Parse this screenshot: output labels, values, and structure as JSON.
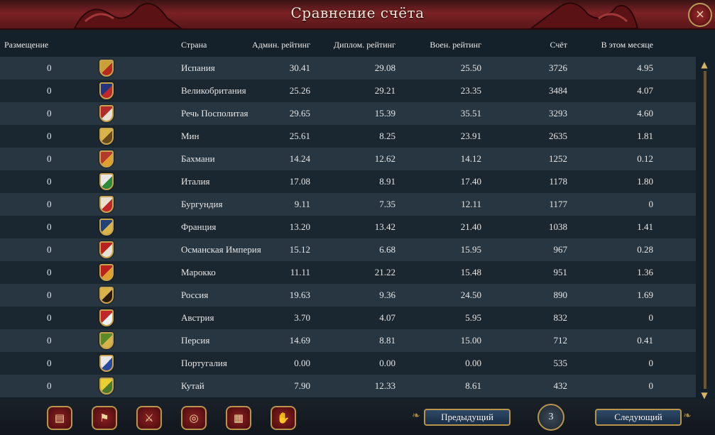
{
  "window": {
    "title": "Сравнение счёта",
    "close_icon": "×"
  },
  "headers": {
    "placement": "Размещение",
    "country": "Страна",
    "admin": "Админ. рейтинг",
    "diplo": "Диплом. рейтинг",
    "military": "Воен. рейтинг",
    "score": "Счёт",
    "this_month": "В этом месяце"
  },
  "rows": [
    {
      "place": "0",
      "country": "Испания",
      "admin": "30.41",
      "diplo": "29.08",
      "military": "25.50",
      "score": "3726",
      "month": "4.95",
      "flag_color": "#c9a13a",
      "flag_accent": "#b52a1f"
    },
    {
      "place": "0",
      "country": "Великобритания",
      "admin": "25.26",
      "diplo": "29.21",
      "military": "23.35",
      "score": "3484",
      "month": "4.07",
      "flag_color": "#22357a",
      "flag_accent": "#c0262a"
    },
    {
      "place": "0",
      "country": "Речь Посполитая",
      "admin": "29.65",
      "diplo": "15.39",
      "military": "35.51",
      "score": "3293",
      "month": "4.60",
      "flag_color": "#b22a2a",
      "flag_accent": "#e8e0d0"
    },
    {
      "place": "0",
      "country": "Мин",
      "admin": "25.61",
      "diplo": "8.25",
      "military": "23.91",
      "score": "2635",
      "month": "1.81",
      "flag_color": "#d9b44a",
      "flag_accent": "#6a4a1a"
    },
    {
      "place": "0",
      "country": "Бахмани",
      "admin": "14.24",
      "diplo": "12.62",
      "military": "14.12",
      "score": "1252",
      "month": "0.12",
      "flag_color": "#b23a2a",
      "flag_accent": "#e0a030"
    },
    {
      "place": "0",
      "country": "Италия",
      "admin": "17.08",
      "diplo": "8.91",
      "military": "17.40",
      "score": "1178",
      "month": "1.80",
      "flag_color": "#e6e6e6",
      "flag_accent": "#2a8a3a"
    },
    {
      "place": "0",
      "country": "Бургундия",
      "admin": "9.11",
      "diplo": "7.35",
      "military": "12.11",
      "score": "1177",
      "month": "0",
      "flag_color": "#e8e0d0",
      "flag_accent": "#c0262a"
    },
    {
      "place": "0",
      "country": "Франция",
      "admin": "13.20",
      "diplo": "13.42",
      "military": "21.40",
      "score": "1038",
      "month": "1.41",
      "flag_color": "#24427a",
      "flag_accent": "#d9b44a"
    },
    {
      "place": "0",
      "country": "Османская Империя",
      "admin": "15.12",
      "diplo": "6.68",
      "military": "15.95",
      "score": "967",
      "month": "0.28",
      "flag_color": "#b8231f",
      "flag_accent": "#e8e0d0"
    },
    {
      "place": "0",
      "country": "Марокко",
      "admin": "11.11",
      "diplo": "21.22",
      "military": "15.48",
      "score": "951",
      "month": "1.36",
      "flag_color": "#b8231f",
      "flag_accent": "#e0a030"
    },
    {
      "place": "0",
      "country": "Россия",
      "admin": "19.63",
      "diplo": "9.36",
      "military": "24.50",
      "score": "890",
      "month": "1.69",
      "flag_color": "#d9b44a",
      "flag_accent": "#2a1a0a"
    },
    {
      "place": "0",
      "country": "Австрия",
      "admin": "3.70",
      "diplo": "4.07",
      "military": "5.95",
      "score": "832",
      "month": "0",
      "flag_color": "#c0262a",
      "flag_accent": "#f0f0f0"
    },
    {
      "place": "0",
      "country": "Персия",
      "admin": "14.69",
      "diplo": "8.81",
      "military": "15.00",
      "score": "712",
      "month": "0.41",
      "flag_color": "#5a8a2a",
      "flag_accent": "#d9b44a"
    },
    {
      "place": "0",
      "country": "Португалия",
      "admin": "0.00",
      "diplo": "0.00",
      "military": "0.00",
      "score": "535",
      "month": "0",
      "flag_color": "#e8e8e8",
      "flag_accent": "#2a4aa0"
    },
    {
      "place": "0",
      "country": "Кутай",
      "admin": "7.90",
      "diplo": "12.33",
      "military": "8.61",
      "score": "432",
      "month": "0",
      "flag_color": "#e8d030",
      "flag_accent": "#4a7a2a"
    }
  ],
  "toolbar": [
    {
      "name": "ledger-icon",
      "glyph": "▤"
    },
    {
      "name": "flag-icon",
      "glyph": "⚑"
    },
    {
      "name": "crossed-swords-icon",
      "glyph": "⚔"
    },
    {
      "name": "coins-icon",
      "glyph": "◎"
    },
    {
      "name": "crate-icon",
      "glyph": "▦"
    },
    {
      "name": "handshake-icon",
      "glyph": "✋"
    }
  ],
  "pagination": {
    "prev_label": "Предыдущий",
    "page": "3",
    "next_label": "Следующий"
  },
  "scroll": {
    "up_icon": "▲",
    "down_icon": "▼"
  },
  "colors": {
    "title_red": "#7a2124",
    "gold_border": "#b8944c",
    "row_light": "#273641",
    "row_dark": "#1a2731"
  }
}
